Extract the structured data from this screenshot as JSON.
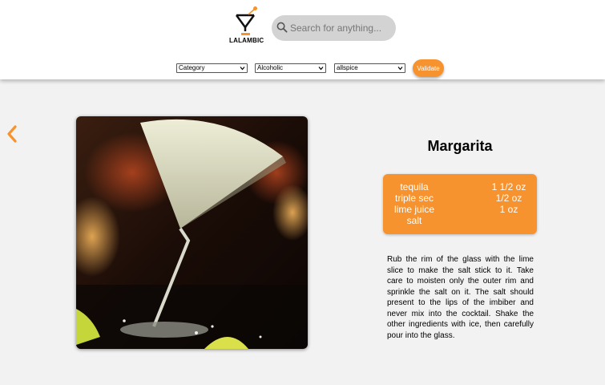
{
  "brand": {
    "name": "LALAMBIC",
    "accent": "#f7932e"
  },
  "search": {
    "placeholder": "Search for anything...",
    "value": "",
    "icon": "search-icon"
  },
  "filters": [
    {
      "selected": "Category"
    },
    {
      "selected": "Alcoholic"
    },
    {
      "selected": "allspice"
    }
  ],
  "validate_label": "Validate",
  "nav": {
    "back_icon": "chevron-left-icon"
  },
  "cocktail": {
    "name": "Margarita",
    "ingredients": [
      {
        "name": "tequila",
        "amount": "1 1/2 oz"
      },
      {
        "name": "triple sec",
        "amount": "1/2 oz"
      },
      {
        "name": "lime juice",
        "amount": "1 oz"
      },
      {
        "name": "salt",
        "amount": ""
      }
    ],
    "instructions": "Rub the rim of the glass with the lime slice to make the salt stick to it. Take care to moisten only the outer rim and sprinkle the salt on it. The salt should present to the lips of the imbiber and never mix into the cocktail. Shake the other ingredients with ice, then carefully pour into the glass."
  }
}
